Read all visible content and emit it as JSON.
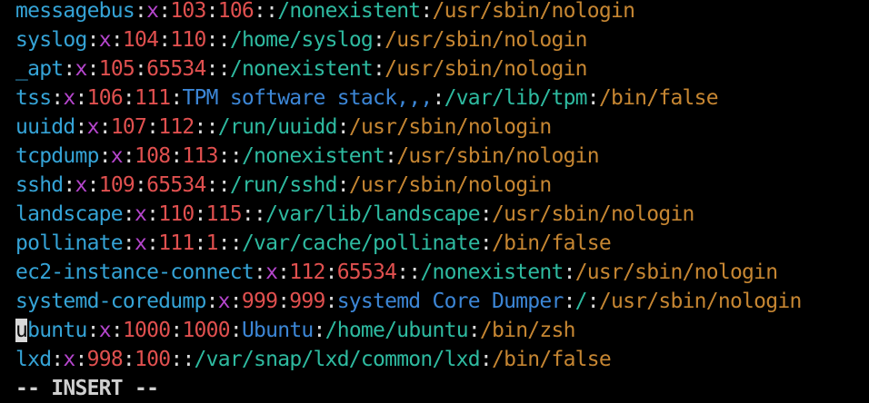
{
  "theme": {
    "background": "#000000",
    "colors": {
      "user": "#35a3d6",
      "separator": "#dcdcdc",
      "password": "#b545cc",
      "uid": "#e0504f",
      "gid": "#e0504f",
      "gecos": "#3c86d6",
      "home": "#2ebaa0",
      "shell": "#c68632"
    }
  },
  "lines": [
    {
      "user": "messagebus",
      "pass": "x",
      "uid": "103",
      "gid": "106",
      "gecos": "",
      "home": "/nonexistent",
      "shell": "/usr/sbin/nologin"
    },
    {
      "user": "syslog",
      "pass": "x",
      "uid": "104",
      "gid": "110",
      "gecos": "",
      "home": "/home/syslog",
      "shell": "/usr/sbin/nologin"
    },
    {
      "user": "_apt",
      "pass": "x",
      "uid": "105",
      "gid": "65534",
      "gecos": "",
      "home": "/nonexistent",
      "shell": "/usr/sbin/nologin"
    },
    {
      "user": "tss",
      "pass": "x",
      "uid": "106",
      "gid": "111",
      "gecos": "TPM software stack,,,",
      "home": "/var/lib/tpm",
      "shell": "/bin/false"
    },
    {
      "user": "uuidd",
      "pass": "x",
      "uid": "107",
      "gid": "112",
      "gecos": "",
      "home": "/run/uuidd",
      "shell": "/usr/sbin/nologin"
    },
    {
      "user": "tcpdump",
      "pass": "x",
      "uid": "108",
      "gid": "113",
      "gecos": "",
      "home": "/nonexistent",
      "shell": "/usr/sbin/nologin"
    },
    {
      "user": "sshd",
      "pass": "x",
      "uid": "109",
      "gid": "65534",
      "gecos": "",
      "home": "/run/sshd",
      "shell": "/usr/sbin/nologin"
    },
    {
      "user": "landscape",
      "pass": "x",
      "uid": "110",
      "gid": "115",
      "gecos": "",
      "home": "/var/lib/landscape",
      "shell": "/usr/sbin/nologin"
    },
    {
      "user": "pollinate",
      "pass": "x",
      "uid": "111",
      "gid": "1",
      "gecos": "",
      "home": "/var/cache/pollinate",
      "shell": "/bin/false"
    },
    {
      "user": "ec2-instance-connect",
      "pass": "x",
      "uid": "112",
      "gid": "65534",
      "gecos": "",
      "home": "/nonexistent",
      "shell": "/usr/sbin/nologin"
    },
    {
      "user": "systemd-coredump",
      "pass": "x",
      "uid": "999",
      "gid": "999",
      "gecos": "systemd Core Dumper",
      "home": "/",
      "shell": "/usr/sbin/nologin"
    },
    {
      "user": "ubuntu",
      "pass": "x",
      "uid": "1000",
      "gid": "1000",
      "gecos": "Ubuntu",
      "home": "/home/ubuntu",
      "shell": "/bin/zsh"
    },
    {
      "user": "lxd",
      "pass": "x",
      "uid": "998",
      "gid": "100",
      "gecos": "",
      "home": "/var/snap/lxd/common/lxd",
      "shell": "/bin/false"
    }
  ],
  "cursor": {
    "line_index": 11,
    "char": "u",
    "rest": "buntu"
  },
  "status": {
    "mode": "-- INSERT --"
  }
}
